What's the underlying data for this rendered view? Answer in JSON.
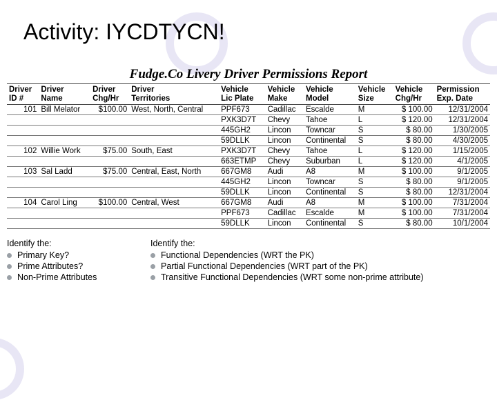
{
  "slide": {
    "title": "Activity: IYCDTYCN!"
  },
  "report": {
    "title": "Fudge.Co Livery Driver Permissions Report",
    "columns": [
      "Driver ID #",
      "Driver Name",
      "Driver Chg/Hr",
      "Driver Territories",
      "Vehicle Lic Plate",
      "Vehicle Make",
      "Vehicle Model",
      "Vehicle Size",
      "Vehicle Chg/Hr",
      "Permission Exp. Date"
    ],
    "rows": [
      {
        "id": "101",
        "name": "Bill Melator",
        "dchg": "$100.00",
        "terr": "West, North, Central",
        "plate": "PPF673",
        "make": "Cadillac",
        "model": "Escalde",
        "size": "M",
        "vchg": "$ 100.00",
        "exp": "12/31/2004"
      },
      {
        "id": "",
        "name": "",
        "dchg": "",
        "terr": "",
        "plate": "PXK3D7T",
        "make": "Chevy",
        "model": "Tahoe",
        "size": "L",
        "vchg": "$ 120.00",
        "exp": "12/31/2004"
      },
      {
        "id": "",
        "name": "",
        "dchg": "",
        "terr": "",
        "plate": "445GH2",
        "make": "Lincon",
        "model": "Towncar",
        "size": "S",
        "vchg": "$  80.00",
        "exp": "1/30/2005"
      },
      {
        "id": "",
        "name": "",
        "dchg": "",
        "terr": "",
        "plate": "59DLLK",
        "make": "Lincon",
        "model": "Continental",
        "size": "S",
        "vchg": "$  80.00",
        "exp": "4/30/2005"
      },
      {
        "id": "102",
        "name": "Willie Work",
        "dchg": "$75.00",
        "terr": "South, East",
        "plate": "PXK3D7T",
        "make": "Chevy",
        "model": "Tahoe",
        "size": "L",
        "vchg": "$ 120.00",
        "exp": "1/15/2005"
      },
      {
        "id": "",
        "name": "",
        "dchg": "",
        "terr": "",
        "plate": "663ETMP",
        "make": "Chevy",
        "model": "Suburban",
        "size": "L",
        "vchg": "$ 120.00",
        "exp": "4/1/2005"
      },
      {
        "id": "103",
        "name": "Sal Ladd",
        "dchg": "$75.00",
        "terr": "Central, East, North",
        "plate": "667GM8",
        "make": "Audi",
        "model": "A8",
        "size": "M",
        "vchg": "$ 100.00",
        "exp": "9/1/2005"
      },
      {
        "id": "",
        "name": "",
        "dchg": "",
        "terr": "",
        "plate": "445GH2",
        "make": "Lincon",
        "model": "Towncar",
        "size": "S",
        "vchg": "$  80.00",
        "exp": "9/1/2005"
      },
      {
        "id": "",
        "name": "",
        "dchg": "",
        "terr": "",
        "plate": "59DLLK",
        "make": "Lincon",
        "model": "Continental",
        "size": "S",
        "vchg": "$  80.00",
        "exp": "12/31/2004"
      },
      {
        "id": "104",
        "name": "Carol Ling",
        "dchg": "$100.00",
        "terr": "Central, West",
        "plate": "667GM8",
        "make": "Audi",
        "model": "A8",
        "size": "M",
        "vchg": "$ 100.00",
        "exp": "7/31/2004"
      },
      {
        "id": "",
        "name": "",
        "dchg": "",
        "terr": "",
        "plate": "PPF673",
        "make": "Cadillac",
        "model": "Escalde",
        "size": "M",
        "vchg": "$ 100.00",
        "exp": "7/31/2004"
      },
      {
        "id": "",
        "name": "",
        "dchg": "",
        "terr": "",
        "plate": "59DLLK",
        "make": "Lincon",
        "model": "Continental",
        "size": "S",
        "vchg": "$  80.00",
        "exp": "10/1/2004"
      }
    ]
  },
  "left": {
    "head": "Identify the:",
    "items": [
      "Primary Key?",
      "Prime Attributes?",
      "Non-Prime Attributes"
    ]
  },
  "right": {
    "head": "Identify the:",
    "items": [
      "Functional Dependencies (WRT the PK)",
      "Partial Functional Dependencies (WRT part of the PK)",
      "Transitive Functional Dependencies (WRT some non-prime attribute)"
    ]
  }
}
